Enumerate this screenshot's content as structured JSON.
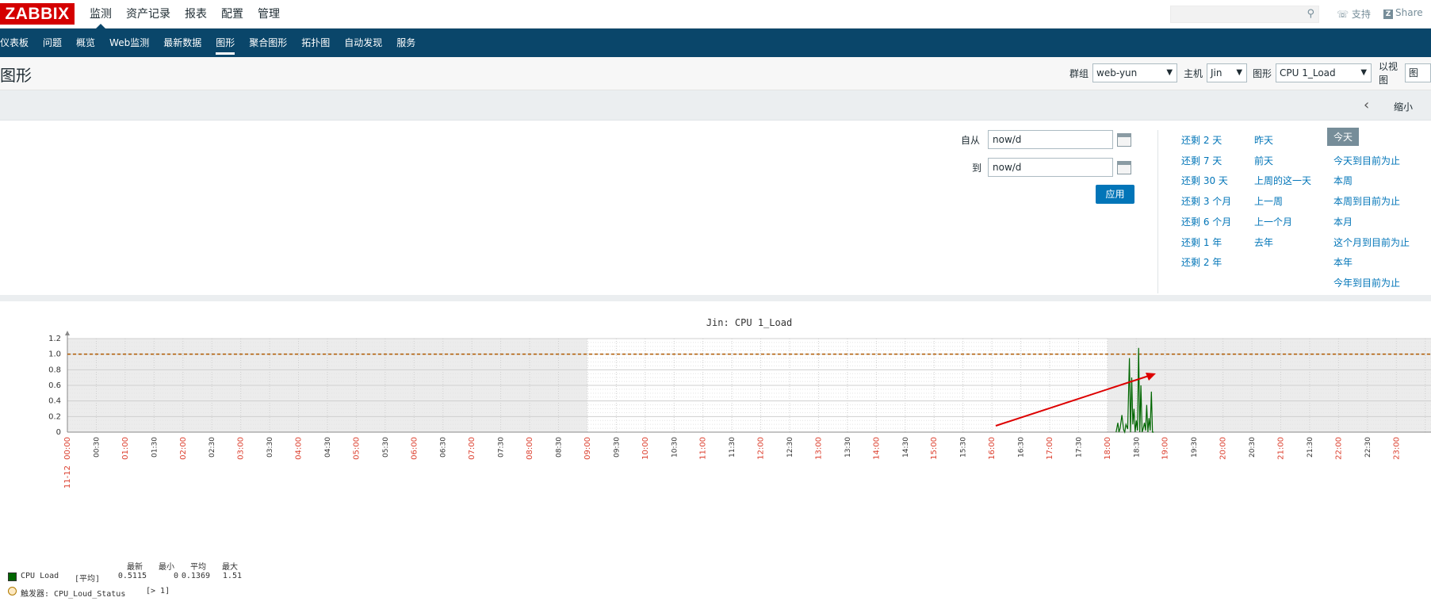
{
  "logo": "ZABBIX",
  "top_menu": [
    {
      "label": "监测",
      "active": true
    },
    {
      "label": "资产记录",
      "active": false
    },
    {
      "label": "报表",
      "active": false
    },
    {
      "label": "配置",
      "active": false
    },
    {
      "label": "管理",
      "active": false
    }
  ],
  "header_links": {
    "support": "支持",
    "share": "Share"
  },
  "sub_menu": [
    {
      "label": "仪表板",
      "active": false
    },
    {
      "label": "问题",
      "active": false
    },
    {
      "label": "概览",
      "active": false
    },
    {
      "label": "Web监测",
      "active": false
    },
    {
      "label": "最新数据",
      "active": false
    },
    {
      "label": "图形",
      "active": true
    },
    {
      "label": "聚合图形",
      "active": false
    },
    {
      "label": "拓扑图",
      "active": false
    },
    {
      "label": "自动发现",
      "active": false
    },
    {
      "label": "服务",
      "active": false
    }
  ],
  "page": {
    "title": "图形",
    "filters": {
      "group_label": "群组",
      "group_value": "web-yun",
      "host_label": "主机",
      "host_value": "Jin",
      "graph_label": "图形",
      "graph_value": "CPU 1_Load",
      "view_label": "以视图",
      "view_value": "图形"
    }
  },
  "timebar": {
    "zoom_out": "缩小"
  },
  "time_filter": {
    "from_label": "自从",
    "from_value": "now/d",
    "to_label": "到",
    "to_value": "now/d",
    "apply_label": "应用",
    "quick_col1": [
      "还剩 2 天",
      "还剩 7 天",
      "还剩 30 天",
      "还剩 3 个月",
      "还剩 6 个月",
      "还剩 1 年",
      "还剩 2 年"
    ],
    "quick_col2": [
      "昨天",
      "前天",
      "上周的这一天",
      "上一周",
      "上一个月",
      "去年"
    ],
    "quick_col3": [
      "今天",
      "今天到目前为止",
      "本周",
      "本周到目前为止",
      "本月",
      "这个月到目前为止",
      "本年",
      "今年到目前为止"
    ]
  },
  "chart_data": {
    "type": "line",
    "title": "Jin: CPU 1_Load",
    "date_label": "11-12",
    "ylim": [
      0,
      1.2
    ],
    "y_ticks": [
      "0",
      "0.2",
      "0.4",
      "0.6",
      "0.8",
      "1.0",
      "1.2"
    ],
    "x_ticks": [
      "00:00",
      "00:30",
      "01:00",
      "01:30",
      "02:00",
      "02:30",
      "03:00",
      "03:30",
      "04:00",
      "04:30",
      "05:00",
      "05:30",
      "06:00",
      "06:30",
      "07:00",
      "07:30",
      "08:00",
      "08:30",
      "09:00",
      "09:30",
      "10:00",
      "10:30",
      "11:00",
      "11:30",
      "12:00",
      "12:30",
      "13:00",
      "13:30",
      "14:00",
      "14:30",
      "15:00",
      "15:30",
      "16:00",
      "16:30",
      "17:00",
      "17:30",
      "18:00",
      "18:30",
      "19:00",
      "19:30",
      "20:00",
      "20:30",
      "21:00",
      "21:30",
      "22:00",
      "22:30",
      "23:00"
    ],
    "trigger_value": 1.0,
    "series": [
      {
        "name": "CPU Load",
        "color": "#006600",
        "x_hours": [
          18.15,
          18.18,
          18.2,
          18.22,
          18.25,
          18.28,
          18.3,
          18.32,
          18.35,
          18.38,
          18.4,
          18.42,
          18.44,
          18.46,
          18.48,
          18.5,
          18.52,
          18.54,
          18.56,
          18.58,
          18.6,
          18.62,
          18.64,
          18.66,
          18.68,
          18.7,
          18.72,
          18.74,
          18.76,
          18.78,
          18.8
        ],
        "y_values": [
          0.0,
          0.12,
          0.0,
          0.05,
          0.22,
          0.03,
          0.0,
          0.1,
          0.04,
          0.95,
          0.0,
          0.7,
          0.1,
          0.3,
          0.0,
          0.15,
          0.02,
          1.08,
          0.0,
          0.6,
          0.0,
          0.05,
          0.12,
          0.02,
          0.35,
          0.0,
          0.18,
          0.02,
          0.52,
          0.0,
          0.0
        ]
      }
    ],
    "legend": {
      "header": [
        "最新",
        "最小",
        "平均",
        "最大"
      ],
      "item_name": "CPU Load",
      "item_func": "[平均]",
      "item_values": [
        "0.5115",
        "0",
        "0.1369",
        "1.51"
      ],
      "trigger_label": "触发器: CPU_Loud_Status",
      "trigger_cond": "[> 1]"
    }
  }
}
